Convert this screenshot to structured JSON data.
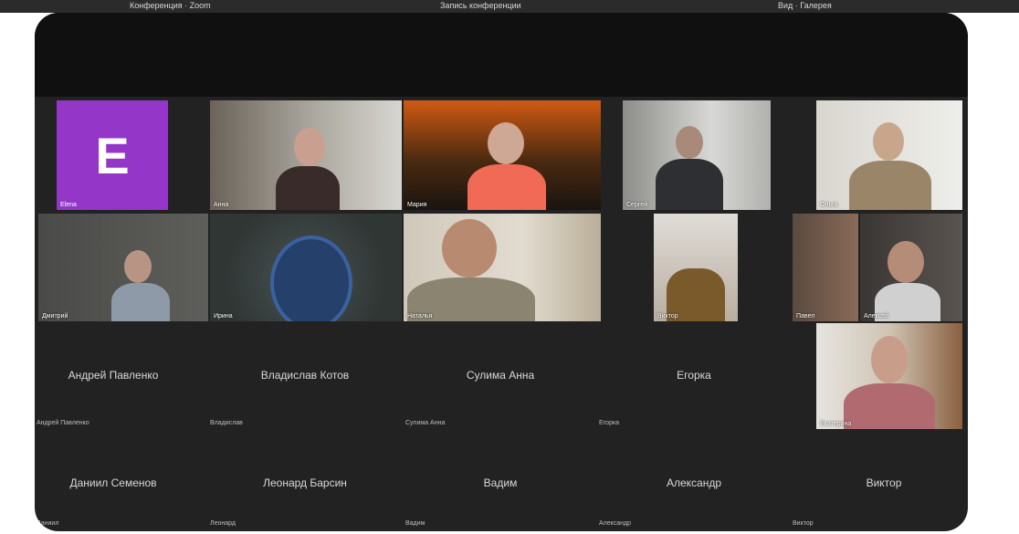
{
  "titlebar": {
    "left_text": "Конференция · Zoom",
    "center_text": "Запись конференции",
    "right_text": "Вид · Галерея"
  },
  "avatar_tile": {
    "initial": "E",
    "name": "Elena",
    "color": "#9437c8"
  },
  "video_tiles": [
    {
      "name": "Анна"
    },
    {
      "name": "Мария"
    },
    {
      "name": "Сергей"
    },
    {
      "name": "Ольга"
    },
    {
      "name": "Дмитрий"
    },
    {
      "name": "Ирина"
    },
    {
      "name": "Наталья"
    },
    {
      "name": "Виктор"
    },
    {
      "name": "Павел"
    },
    {
      "name": "Алексей"
    },
    {
      "name": "Екатерина"
    }
  ],
  "name_only_row1": [
    {
      "big": "Андрей Павленко",
      "small": "Андрей Павленко"
    },
    {
      "big": "Владислав Котов",
      "small": "Владислав"
    },
    {
      "big": "Сулима Анна",
      "small": "Сулима Анна"
    },
    {
      "big": "Егорка",
      "small": "Егорка"
    }
  ],
  "name_only_row2": [
    {
      "big": "Даниил Семенов",
      "small": "Даниил"
    },
    {
      "big": "Леонард Барсин",
      "small": "Леонард"
    },
    {
      "big": "Вадим",
      "small": "Вадим"
    },
    {
      "big": "Александр",
      "small": "Александр"
    },
    {
      "big": "Виктор",
      "small": "Виктор"
    }
  ]
}
